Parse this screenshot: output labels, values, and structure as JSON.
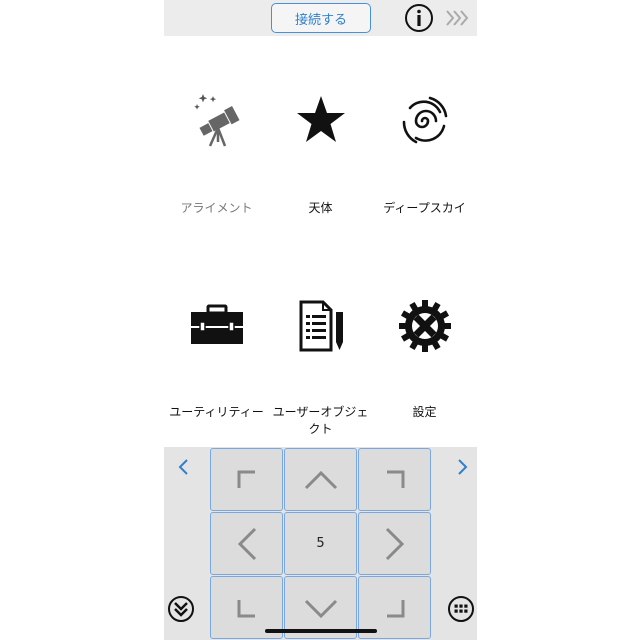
{
  "topbar": {
    "connect_label": "接続する",
    "info_icon": "info-icon",
    "forward_icon": "triple-chevron-right-icon"
  },
  "menu": [
    {
      "label": "アライメント",
      "icon": "telescope-icon",
      "muted": true
    },
    {
      "label": "天体",
      "icon": "star-icon",
      "muted": false
    },
    {
      "label": "ディープスカイ",
      "icon": "galaxy-icon",
      "muted": false
    },
    {
      "label": "ユーティリティー",
      "icon": "toolbox-icon",
      "muted": false
    },
    {
      "label": "ユーザーオブジェクト",
      "icon": "document-pencil-icon",
      "muted": false
    },
    {
      "label": "設定",
      "icon": "gear-icon",
      "muted": false
    }
  ],
  "keypad": {
    "speed_value": "5",
    "left_nav_icon": "chevron-left-icon",
    "right_nav_icon": "chevron-right-icon",
    "collapse_icon": "double-chevron-down-icon",
    "grid_icon": "keypad-grid-icon"
  },
  "colors": {
    "accent": "#2f7fd0",
    "key_bg": "#dcdcdc",
    "key_border": "#7aa7e0",
    "arrow": "#8a8a8a"
  }
}
